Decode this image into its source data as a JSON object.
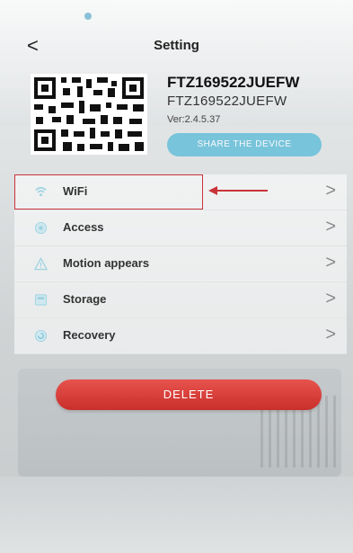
{
  "header": {
    "back_glyph": "<",
    "title": "Setting"
  },
  "device": {
    "name": "FTZ169522JUEFW",
    "id": "FTZ169522JUEFW",
    "version": "Ver:2.4.5.37",
    "share_label": "SHARE THE DEVICE"
  },
  "menu": {
    "items": [
      {
        "label": "WiFi",
        "icon": "wifi-icon",
        "chevron": ">"
      },
      {
        "label": "Access",
        "icon": "access-icon",
        "chevron": ">"
      },
      {
        "label": "Motion appears",
        "icon": "warning-triangle-icon",
        "chevron": ">"
      },
      {
        "label": "Storage",
        "icon": "storage-icon",
        "chevron": ">"
      },
      {
        "label": "Recovery",
        "icon": "recovery-icon",
        "chevron": ">"
      }
    ]
  },
  "delete_label": "DELETE",
  "colors": {
    "accent": "#66bfd9",
    "delete": "#d83b36",
    "highlight": "#c9333a"
  }
}
